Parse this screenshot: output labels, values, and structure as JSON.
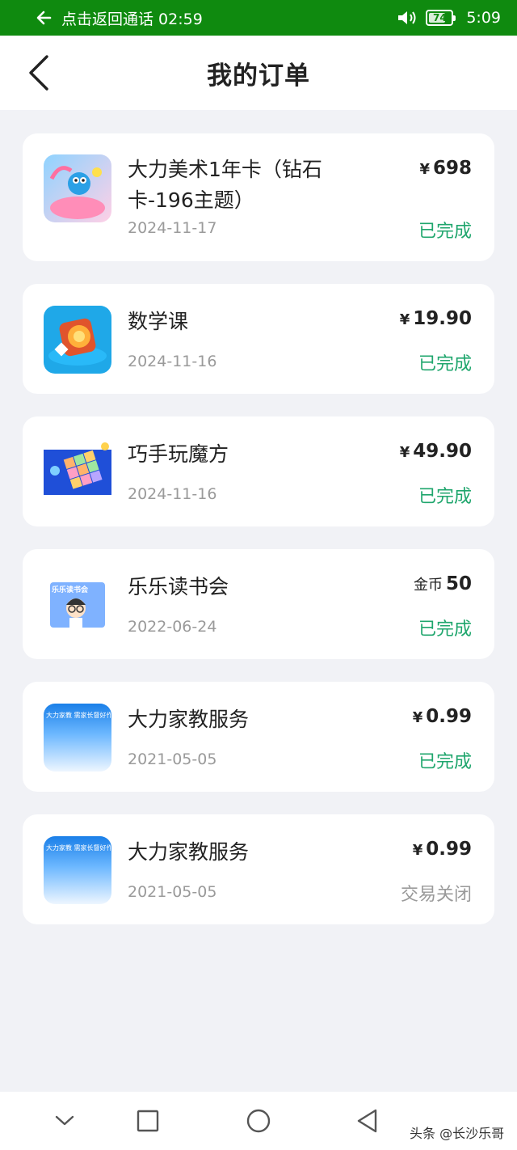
{
  "status_bar": {
    "call_text": "点击返回通话 02:59",
    "battery": "74",
    "battery_level": 0.74,
    "time": "5:09"
  },
  "header": {
    "title": "我的订单"
  },
  "orders": [
    {
      "name": "大力美术1年卡（钻石卡-196主题）",
      "date": "2024-11-17",
      "currency": "¥",
      "amount": "698",
      "status": "已完成",
      "thumb_icon": "art-course-icon"
    },
    {
      "name": "数学课",
      "date": "2024-11-16",
      "currency": "¥",
      "amount": "19.90",
      "status": "已完成",
      "thumb_icon": "math-course-icon"
    },
    {
      "name": "巧手玩魔方",
      "date": "2024-11-16",
      "currency": "¥",
      "amount": "49.90",
      "status": "已完成",
      "thumb_icon": "rubiks-cube-icon"
    },
    {
      "name": "乐乐读书会",
      "date": "2022-06-24",
      "currency": "金币",
      "amount": "50",
      "status": "已完成",
      "thumb_text": "乐乐读书会",
      "thumb_icon": "reading-club-icon"
    },
    {
      "name": "大力家教服务",
      "date": "2021-05-05",
      "currency": "¥",
      "amount": "0.99",
      "status": "已完成",
      "thumb_text": "大力家教 需家长督好作业",
      "thumb_icon": "tutoring-service-icon"
    },
    {
      "name": "大力家教服务",
      "date": "2021-05-05",
      "currency": "¥",
      "amount": "0.99",
      "status": "交易关闭",
      "thumb_text": "大力家教 需家长督好作业",
      "thumb_icon": "tutoring-service-icon"
    }
  ],
  "watermark": "头条 @长沙乐哥",
  "colors": {
    "status_bar": "#0f8a0f",
    "completed": "#1fa66d",
    "closed": "#9a9a9a",
    "background": "#f1f2f6"
  }
}
